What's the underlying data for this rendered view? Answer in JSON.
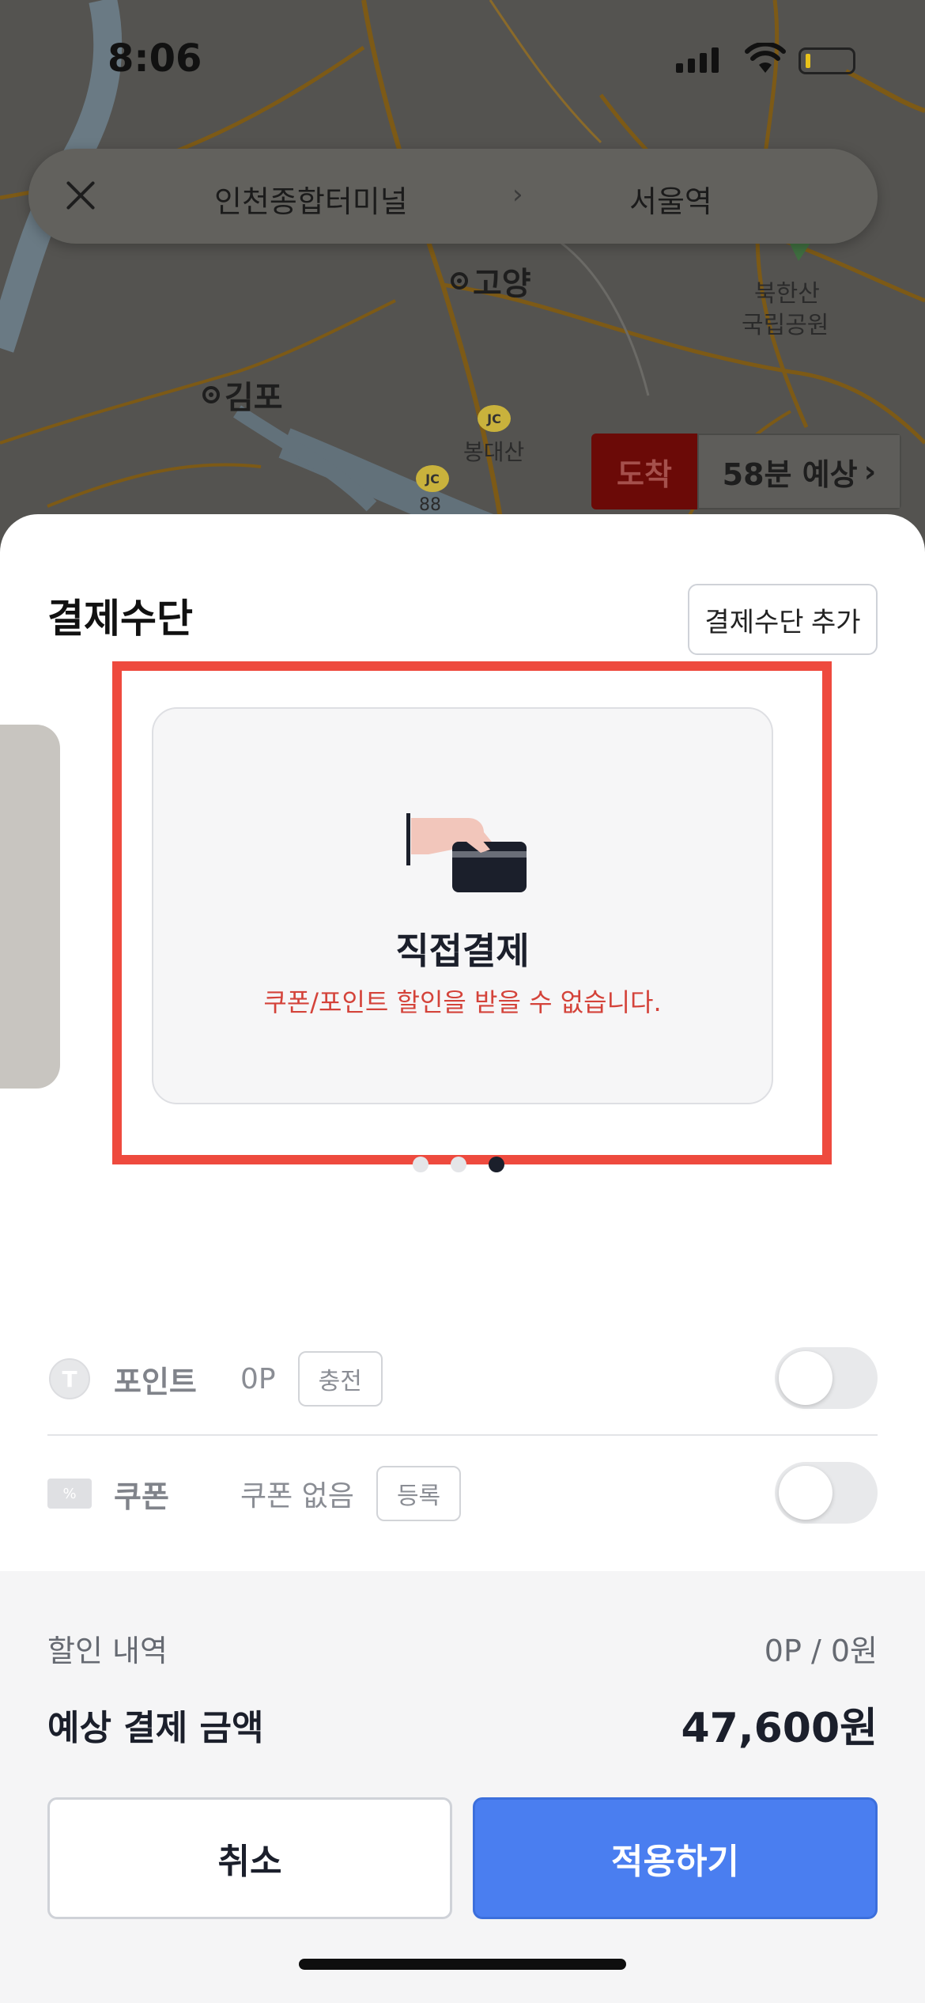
{
  "status_bar": {
    "time": "8:06"
  },
  "map": {
    "labels": {
      "goyang": "고양",
      "gimpo": "김포",
      "bukhansan_line1": "북한산",
      "bukhansan_line2": "국립공원",
      "bongdaesan": "봉대산",
      "jc": "JC",
      "route_num": "88"
    }
  },
  "route": {
    "from": "인천종합터미널",
    "arrow": "›",
    "to": "서울역"
  },
  "arrival": {
    "tag": "도착",
    "eta": "58분 예상",
    "chevron": "›"
  },
  "sheet": {
    "title": "결제수단",
    "add_button": "결제수단 추가",
    "card": {
      "title": "직접결제",
      "note": "쿠폰/포인트 할인을 받을 수 없습니다."
    },
    "carousel": {
      "count": 3,
      "active_index": 2
    },
    "points": {
      "icon_letter": "T",
      "label": "포인트",
      "value": "0P",
      "button": "충전",
      "enabled": false
    },
    "coupon": {
      "label": "쿠폰",
      "value": "쿠폰 없음",
      "button": "등록",
      "enabled": false
    }
  },
  "summary": {
    "discount_label": "할인 내역",
    "discount_value": "0P / 0원",
    "total_label": "예상 결제 금액",
    "total_value": "47,600원"
  },
  "actions": {
    "cancel": "취소",
    "apply": "적용하기"
  },
  "colors": {
    "accent": "#4a7ef0",
    "warning": "#d4433a",
    "highlight": "#ee4a3e"
  }
}
